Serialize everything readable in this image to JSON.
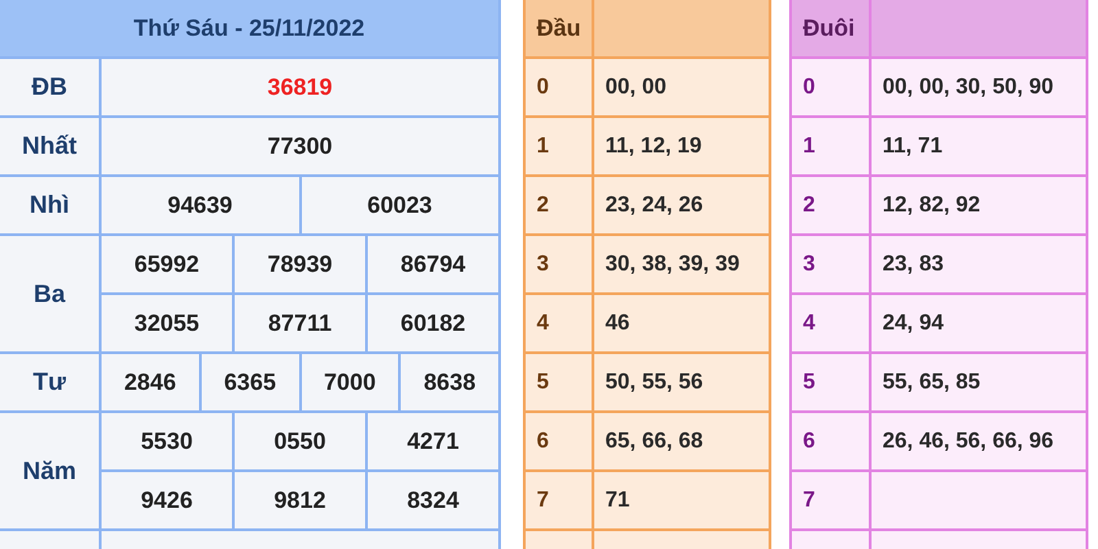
{
  "results": {
    "title": "Thứ Sáu - 25/11/2022",
    "prizes": [
      {
        "label": "ĐB",
        "kind": "special",
        "rows": [
          [
            "36819"
          ]
        ]
      },
      {
        "label": "Nhất",
        "kind": "normal",
        "rows": [
          [
            "77300"
          ]
        ]
      },
      {
        "label": "Nhì",
        "kind": "normal",
        "rows": [
          [
            "94639",
            "60023"
          ]
        ]
      },
      {
        "label": "Ba",
        "kind": "normal",
        "rows": [
          [
            "65992",
            "78939",
            "86794"
          ],
          [
            "32055",
            "87711",
            "60182"
          ]
        ]
      },
      {
        "label": "Tư",
        "kind": "normal",
        "rows": [
          [
            "2846",
            "6365",
            "7000",
            "8638"
          ]
        ]
      },
      {
        "label": "Năm",
        "kind": "normal",
        "rows": [
          [
            "5530",
            "0550",
            "4271"
          ],
          [
            "9426",
            "9812",
            "8324"
          ]
        ]
      }
    ]
  },
  "loto_tables": [
    {
      "kind": "head",
      "label": "Đầu",
      "rows": [
        {
          "digit": "0",
          "values": "00, 00"
        },
        {
          "digit": "1",
          "values": "11, 12, 19"
        },
        {
          "digit": "2",
          "values": "23, 24, 26"
        },
        {
          "digit": "3",
          "values": "30, 38, 39, 39"
        },
        {
          "digit": "4",
          "values": "46"
        },
        {
          "digit": "5",
          "values": "50, 55, 56"
        },
        {
          "digit": "6",
          "values": "65, 66, 68"
        },
        {
          "digit": "7",
          "values": "71"
        }
      ]
    },
    {
      "kind": "tail",
      "label": "Đuôi",
      "rows": [
        {
          "digit": "0",
          "values": "00, 00, 30, 50, 90"
        },
        {
          "digit": "1",
          "values": "11, 71"
        },
        {
          "digit": "2",
          "values": "12, 82, 92"
        },
        {
          "digit": "3",
          "values": "23, 83"
        },
        {
          "digit": "4",
          "values": "24, 94"
        },
        {
          "digit": "5",
          "values": "55, 65, 85"
        },
        {
          "digit": "6",
          "values": "26, 46, 56, 66, 96"
        },
        {
          "digit": "7"
        }
      ]
    }
  ]
}
